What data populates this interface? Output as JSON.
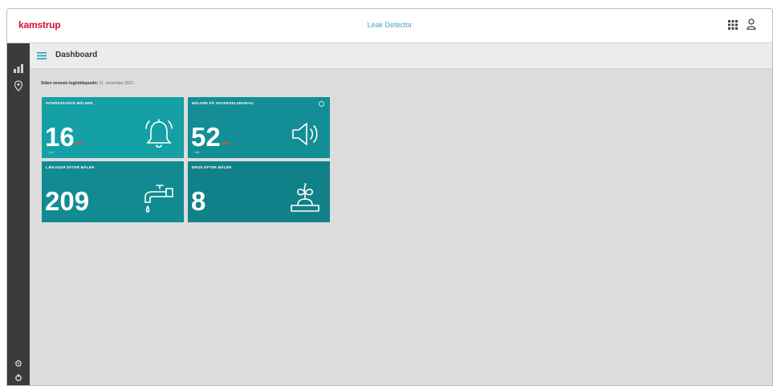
{
  "header": {
    "logo_text": "kamstrup",
    "app_title": "Leak Detector",
    "icons": [
      "apps-grid-icon",
      "user-icon"
    ]
  },
  "sidebar": {
    "icons": [
      "bar-chart-icon",
      "map-pin-icon",
      "settings-icon",
      "logout-icon"
    ]
  },
  "subheader": {
    "menu_icon": "hamburger-menu-icon",
    "title": "Dashboard"
  },
  "last_login": {
    "label": "Siden seneste logintidspunkt:",
    "value": "11. november 2021"
  },
  "tiles": [
    {
      "title": "INTERESSANTE MÅLERE",
      "value": "16",
      "sub": "1 af",
      "icon": "bell-icon",
      "color": "#14a0a4",
      "has_red_dash": true
    },
    {
      "title": "MÅLERE PÅ ADVARSELSNIVEAU",
      "value": "52",
      "sub": "i alt",
      "icon": "speaker-icon",
      "color": "#138e96",
      "has_red_dash": true
    },
    {
      "title": "LÆKAGER EFTER MÅLER",
      "value": "209",
      "sub": "",
      "icon": "tap-drip-icon",
      "color": "#128a92",
      "has_red_dash": false
    },
    {
      "title": "BRUD EFTER MÅLER",
      "value": "8",
      "sub": "",
      "icon": "burst-pipe-icon",
      "color": "#118189",
      "has_red_dash": false
    }
  ],
  "colors": {
    "brand_red": "#d0103a",
    "title_blue": "#45a6c8",
    "sidebar": "#3b3b3b",
    "background": "#dcdcdc"
  }
}
